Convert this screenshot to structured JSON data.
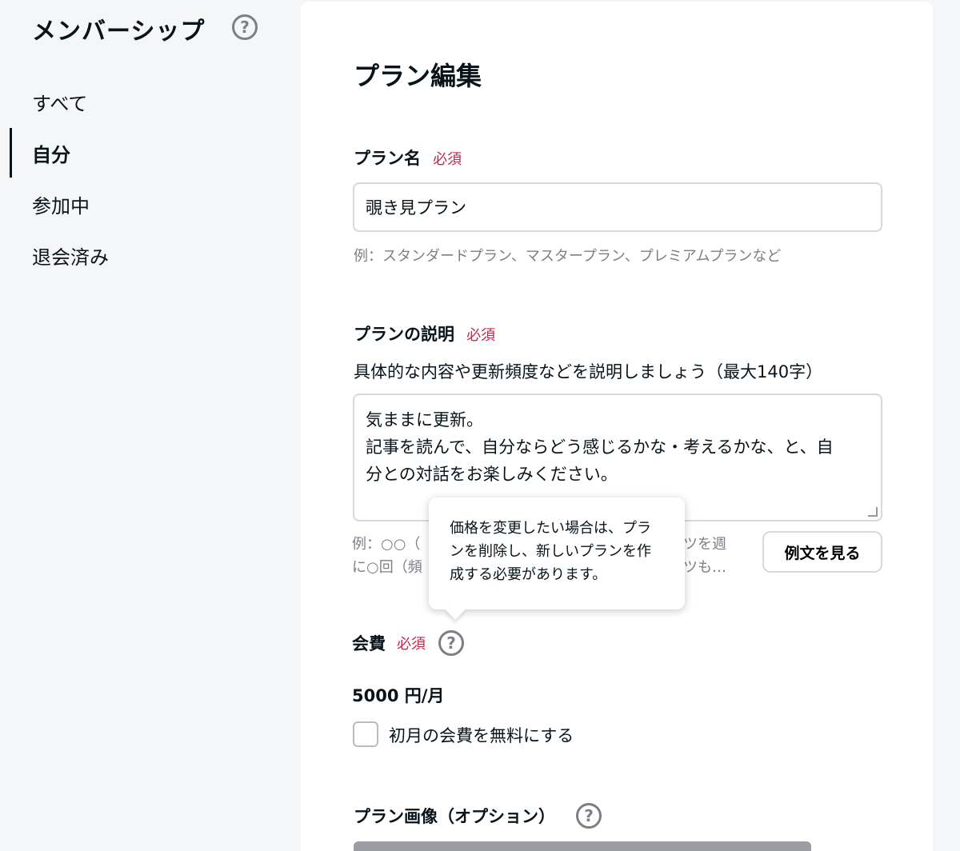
{
  "sidebar": {
    "title": "メンバーシップ",
    "help_icon": "question-circle-icon",
    "items": [
      {
        "label": "すべて",
        "active": false
      },
      {
        "label": "自分",
        "active": true
      },
      {
        "label": "参加中",
        "active": false
      },
      {
        "label": "退会済み",
        "active": false
      }
    ]
  },
  "main": {
    "title": "プラン編集",
    "required_label": "必須",
    "plan_name": {
      "label": "プラン名",
      "value": "覗き見プラン",
      "hint": "例：スタンダードプラン、マスタープラン、プレミアムプランなど"
    },
    "plan_description": {
      "label": "プランの説明",
      "help_text": "具体的な内容や更新頻度などを説明しましょう（最大140字）",
      "value_lines": [
        "気ままに更新。",
        "記事を読んで、自分ならどう感じるかな・考えるかな、と、自",
        "分との対話をお楽しみください。"
      ],
      "hint_lines": [
        "例：○○（",
        "に○回（頻"
      ],
      "hint_lines_right": [
        "ツを週",
        "ツも…"
      ],
      "example_button": "例文を見る"
    },
    "tooltip": {
      "lines": [
        "価格を変更したい場合は、プラ",
        "ンを削除し、新しいプランを作",
        "成する必要があります。"
      ]
    },
    "fee": {
      "label": "会費",
      "price": "5000 円/月",
      "first_month_free_label": "初月の会費を無料にする",
      "first_month_free_checked": false
    },
    "plan_image": {
      "label": "プラン画像（オプション）"
    }
  },
  "colors": {
    "background": "#f5f6f7",
    "card": "#ffffff",
    "required": "#c6284b",
    "text": "#08131a",
    "muted": "#7c7f84"
  }
}
